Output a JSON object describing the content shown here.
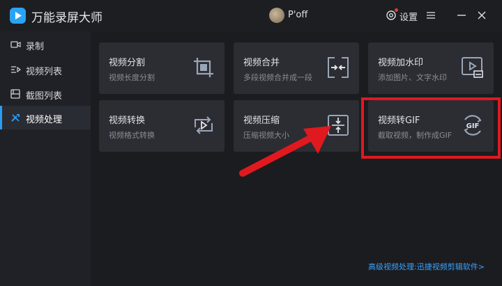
{
  "app": {
    "title": "万能录屏大师"
  },
  "header": {
    "username": "P'off",
    "settings_label": "设置",
    "accent": "#2a9df4"
  },
  "sidebar": {
    "items": [
      {
        "label": "录制",
        "icon": "camera-icon",
        "active": false
      },
      {
        "label": "视频列表",
        "icon": "list-icon",
        "active": false
      },
      {
        "label": "截图列表",
        "icon": "image-icon",
        "active": false
      },
      {
        "label": "视频处理",
        "icon": "tools-icon",
        "active": true
      }
    ]
  },
  "cards": [
    {
      "title": "视频分割",
      "subtitle": "视频长度分割",
      "icon": "crop-icon"
    },
    {
      "title": "视频合并",
      "subtitle": "多段视频合并成一段",
      "icon": "merge-icon"
    },
    {
      "title": "视频加水印",
      "subtitle": "添加图片、文字水印",
      "icon": "watermark-icon"
    },
    {
      "title": "视频转换",
      "subtitle": "视频格式转换",
      "icon": "convert-icon"
    },
    {
      "title": "视频压缩",
      "subtitle": "压缩视频大小",
      "icon": "compress-icon"
    },
    {
      "title": "视频转GIF",
      "subtitle": "截取视频，制作成GIF",
      "icon": "gif-icon",
      "icon_text": "GIF"
    }
  ],
  "footer": {
    "link_text": "高级视频处理:迅捷视频剪辑软件>"
  },
  "annotation_colors": {
    "highlight": "#e0191f"
  }
}
